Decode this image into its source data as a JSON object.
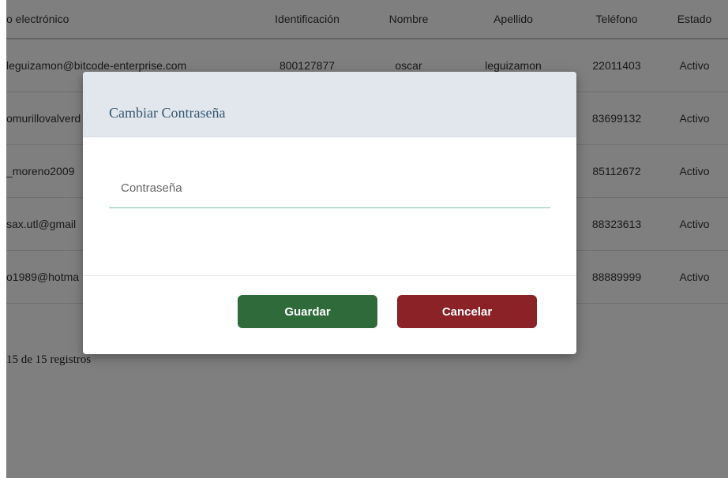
{
  "table": {
    "headers": [
      "o electrónico",
      "Identificación",
      "Nombre",
      "Apellido",
      "Teléfono",
      "Estado"
    ],
    "rows": [
      [
        "leguizamon@bitcode-enterprise.com",
        "800127877",
        "oscar",
        "leguizamon",
        "22011403",
        "Activo"
      ],
      [
        "omurillovalverd",
        "",
        "",
        "",
        "83699132",
        "Activo"
      ],
      [
        "_moreno2009",
        "",
        "",
        "",
        "85112672",
        "Activo"
      ],
      [
        "sax.utl@gmail",
        "",
        "",
        "",
        "88323613",
        "Activo"
      ],
      [
        "o1989@hotma",
        "",
        "",
        "",
        "88889999",
        "Activo"
      ]
    ]
  },
  "pagination": {
    "summary": "15 de 15 registros"
  },
  "modal": {
    "title": "Cambiar Contraseña",
    "password_placeholder": "Contraseña",
    "password_value": "",
    "save_label": "Guardar",
    "cancel_label": "Cancelar"
  },
  "colors": {
    "save_button": "#2e6a3a",
    "cancel_button": "#8a2227",
    "input_underline": "#7cc2ae",
    "modal_header": "#e2e7ee"
  }
}
